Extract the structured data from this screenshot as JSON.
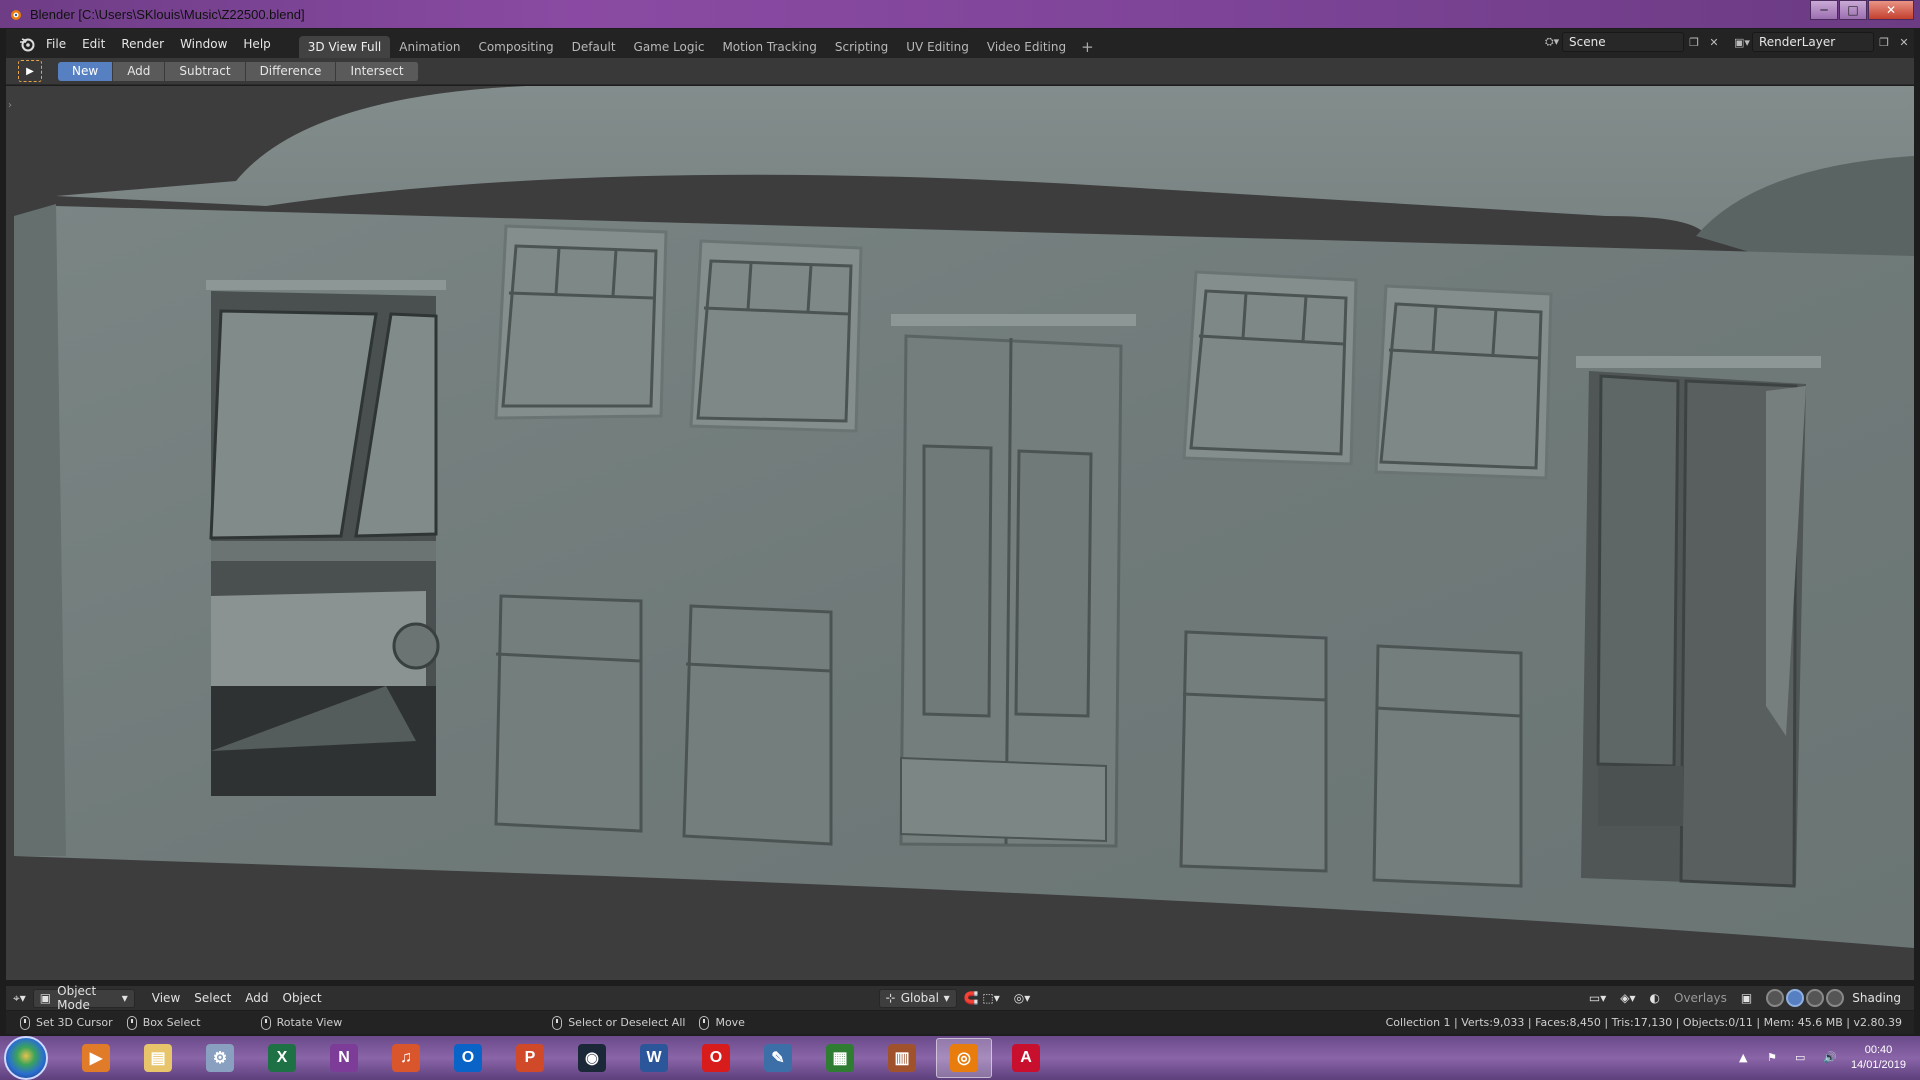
{
  "window": {
    "title": "Blender [C:\\Users\\SKlouis\\Music\\Z22500.blend]",
    "minimize": "─",
    "maximize": "□",
    "close": "✕"
  },
  "menu": [
    "File",
    "Edit",
    "Render",
    "Window",
    "Help"
  ],
  "workspaces": {
    "tabs": [
      "3D View Full",
      "Animation",
      "Compositing",
      "Default",
      "Game Logic",
      "Motion Tracking",
      "Scripting",
      "UV Editing",
      "Video Editing"
    ],
    "active": "3D View Full",
    "add": "+"
  },
  "scene": {
    "name": "Scene",
    "render_layer": "RenderLayer"
  },
  "tool_header": {
    "boolean_modes": [
      "New",
      "Add",
      "Subtract",
      "Difference",
      "Intersect"
    ],
    "active": "New"
  },
  "viewport_header": {
    "mode": "Object Mode",
    "menus": [
      "View",
      "Select",
      "Add",
      "Object"
    ],
    "orientation": "Global",
    "overlays": "Overlays",
    "shading": "Shading"
  },
  "status_bar": {
    "hints": [
      "Set 3D Cursor",
      "Box Select",
      "Rotate View",
      "Select or Deselect All",
      "Move"
    ],
    "stats": "Collection 1 | Verts:9,033 | Faces:8,450 | Tris:17,130 | Objects:0/11 | Mem: 45.6 MB | v2.80.39"
  },
  "taskbar": {
    "apps": [
      {
        "name": "media-player",
        "label": "▶",
        "color": "#e07b2a"
      },
      {
        "name": "file-explorer",
        "label": "▤",
        "color": "#e8c46a"
      },
      {
        "name": "settings",
        "label": "⚙",
        "color": "#8aa0c0"
      },
      {
        "name": "excel",
        "label": "X",
        "color": "#1e7145"
      },
      {
        "name": "onenote",
        "label": "N",
        "color": "#7d3c98"
      },
      {
        "name": "headphones-app",
        "label": "♫",
        "color": "#d9552c"
      },
      {
        "name": "outlook",
        "label": "O",
        "color": "#0a64c8"
      },
      {
        "name": "powerpoint",
        "label": "P",
        "color": "#d04a2a"
      },
      {
        "name": "steam",
        "label": "◉",
        "color": "#1b2838"
      },
      {
        "name": "word",
        "label": "W",
        "color": "#2b579a"
      },
      {
        "name": "opera",
        "label": "O",
        "color": "#d81b1b"
      },
      {
        "name": "paint-app",
        "label": "✎",
        "color": "#3c6ea8"
      },
      {
        "name": "monitor-app",
        "label": "▦",
        "color": "#2e7d32"
      },
      {
        "name": "winrar",
        "label": "▥",
        "color": "#a0522d"
      },
      {
        "name": "blender",
        "label": "◎",
        "color": "#e87d0d"
      },
      {
        "name": "acrobat",
        "label": "A",
        "color": "#c8102e"
      }
    ],
    "active_app": "blender",
    "time": "00:40",
    "date": "14/01/2019"
  }
}
